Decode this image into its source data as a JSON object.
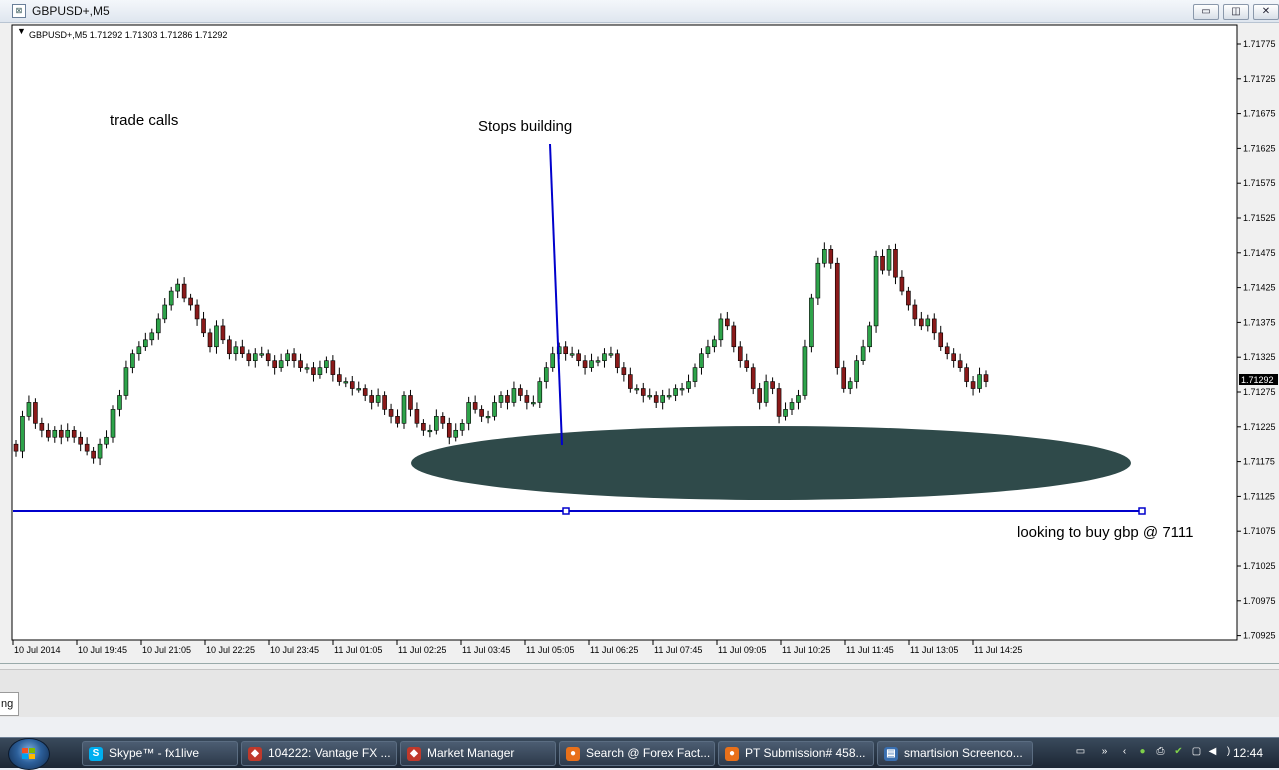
{
  "window": {
    "title": "GBPUSD+,M5"
  },
  "chart": {
    "header": "GBPUSD+,M5  1.71292 1.71303 1.71286 1.71292",
    "current_price": "1.71292",
    "annotations": {
      "trade_calls": "trade calls",
      "stops_building": "Stops building",
      "buy_note": "looking to buy gbp @ 7111"
    },
    "colors": {
      "bull": "#2ea34a",
      "bear": "#8a1a1a",
      "line": "#0000cc",
      "ellipse": "#2f4a4a"
    }
  },
  "chart_data": {
    "type": "candlestick",
    "symbol": "GBPUSD+",
    "timeframe": "M5",
    "ylim": [
      1.70925,
      1.718
    ],
    "y_ticks": [
      "1.71775",
      "1.71725",
      "1.71675",
      "1.71625",
      "1.71575",
      "1.71525",
      "1.71475",
      "1.71425",
      "1.71375",
      "1.71325",
      "1.71275",
      "1.71225",
      "1.71175",
      "1.71125",
      "1.71075",
      "1.71025",
      "1.70975",
      "1.70925"
    ],
    "x_ticks": [
      "10 Jul 2014",
      "10 Jul 19:45",
      "10 Jul 21:05",
      "10 Jul 22:25",
      "10 Jul 23:45",
      "11 Jul 01:05",
      "11 Jul 02:25",
      "11 Jul 03:45",
      "11 Jul 05:05",
      "11 Jul 06:25",
      "11 Jul 07:45",
      "11 Jul 09:05",
      "11 Jul 10:25",
      "11 Jul 11:45",
      "11 Jul 13:05",
      "11 Jul 14:25"
    ],
    "closes": [
      1.7119,
      1.7124,
      1.7126,
      1.7123,
      1.7122,
      1.7121,
      1.7122,
      1.7121,
      1.7122,
      1.7121,
      1.712,
      1.7119,
      1.7118,
      1.712,
      1.7121,
      1.7125,
      1.7127,
      1.7131,
      1.7133,
      1.7134,
      1.7135,
      1.7136,
      1.7138,
      1.714,
      1.7142,
      1.7143,
      1.7141,
      1.714,
      1.7138,
      1.7136,
      1.7134,
      1.7137,
      1.7135,
      1.7133,
      1.7134,
      1.7133,
      1.7132,
      1.7133,
      1.7133,
      1.7132,
      1.7131,
      1.7132,
      1.7133,
      1.7132,
      1.7131,
      1.7131,
      1.713,
      1.7131,
      1.7132,
      1.713,
      1.7129,
      1.7129,
      1.7128,
      1.7128,
      1.7127,
      1.7126,
      1.7127,
      1.7125,
      1.7124,
      1.7123,
      1.7127,
      1.7125,
      1.7123,
      1.7122,
      1.7122,
      1.7124,
      1.7123,
      1.7121,
      1.7122,
      1.7123,
      1.7126,
      1.7125,
      1.7124,
      1.7124,
      1.7126,
      1.7127,
      1.7126,
      1.7128,
      1.7127,
      1.7126,
      1.7126,
      1.7129,
      1.7131,
      1.7133,
      1.7134,
      1.7133,
      1.7133,
      1.7132,
      1.7131,
      1.7132,
      1.7132,
      1.7133,
      1.7133,
      1.7131,
      1.713,
      1.7128,
      1.7128,
      1.7127,
      1.7127,
      1.7126,
      1.7127,
      1.7127,
      1.7128,
      1.7128,
      1.7129,
      1.7131,
      1.7133,
      1.7134,
      1.7135,
      1.7138,
      1.7137,
      1.7134,
      1.7132,
      1.7131,
      1.7128,
      1.7126,
      1.7129,
      1.7128,
      1.7124,
      1.7125,
      1.7126,
      1.7127,
      1.7134,
      1.7141,
      1.7146,
      1.7148,
      1.7146,
      1.7131,
      1.7128,
      1.7129,
      1.7132,
      1.7134,
      1.7137,
      1.7147,
      1.7145,
      1.7148,
      1.7144,
      1.7142,
      1.714,
      1.7138,
      1.7137,
      1.7138,
      1.7136,
      1.7134,
      1.7133,
      1.7132,
      1.7131,
      1.7129,
      1.7128,
      1.713,
      1.7129
    ]
  },
  "taskbar": {
    "tasks": [
      {
        "label": "Skype™ - fx1live",
        "icon": "S",
        "color": "#00aff0"
      },
      {
        "label": "104222: Vantage FX ...",
        "icon": "◆",
        "color": "#c0392b"
      },
      {
        "label": "Market Manager",
        "icon": "◆",
        "color": "#c0392b"
      },
      {
        "label": "Search @ Forex Fact...",
        "icon": "●",
        "color": "#e8701a"
      },
      {
        "label": "PT Submission# 458...",
        "icon": "●",
        "color": "#e8701a"
      },
      {
        "label": "smartision Screenco...",
        "icon": "▤",
        "color": "#3a6fb0"
      }
    ],
    "clock": "12:44"
  },
  "bottom_tab": {
    "label": "ng"
  }
}
